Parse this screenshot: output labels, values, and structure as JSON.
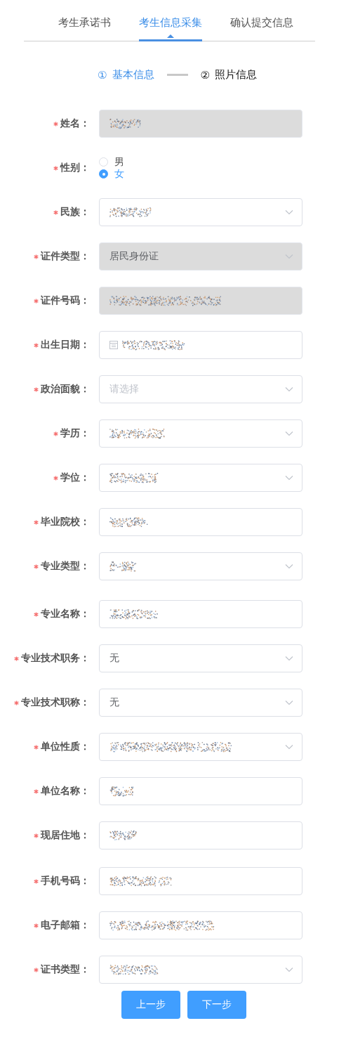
{
  "tabs": [
    {
      "label": "考生承诺书",
      "selected": false
    },
    {
      "label": "考生信息采集",
      "selected": true
    },
    {
      "label": "确认提交信息",
      "selected": false
    }
  ],
  "steps": [
    {
      "number": "①",
      "label": "基本信息",
      "selected": true
    },
    {
      "number": "②",
      "label": "照片信息",
      "selected": false
    }
  ],
  "fields": [
    {
      "label": "姓名：",
      "required": true,
      "kind": "text",
      "disabled": true,
      "obscured": true
    },
    {
      "label": "性别：",
      "required": true,
      "kind": "radio",
      "options": [
        {
          "label": "男",
          "selected": false
        },
        {
          "label": "女",
          "selected": true
        }
      ]
    },
    {
      "label": "民族：",
      "required": true,
      "kind": "select",
      "disabled": false,
      "obscured": true
    },
    {
      "label": "证件类型：",
      "required": true,
      "kind": "select",
      "disabled": true,
      "value": "居民身份证"
    },
    {
      "label": "证件号码：",
      "required": true,
      "kind": "text",
      "disabled": true,
      "obscured": true
    },
    {
      "label": "出生日期：",
      "required": true,
      "kind": "date",
      "disabled": false,
      "obscured": true
    },
    {
      "label": "政治面貌：",
      "required": true,
      "kind": "select",
      "disabled": false,
      "placeholder": "请选择"
    },
    {
      "label": "学历：",
      "required": true,
      "kind": "select",
      "disabled": false,
      "obscured": true
    },
    {
      "label": "学位：",
      "required": true,
      "kind": "select",
      "disabled": false,
      "obscured": true
    },
    {
      "label": "毕业院校：",
      "required": true,
      "kind": "text",
      "disabled": false,
      "obscured": true
    },
    {
      "label": "专业类型：",
      "required": true,
      "kind": "select",
      "disabled": false,
      "obscured": true
    },
    {
      "label": "专业名称：",
      "required": true,
      "kind": "text",
      "disabled": false,
      "obscured": true
    },
    {
      "label": "专业技术职务：",
      "required": true,
      "kind": "select",
      "disabled": false,
      "value": "无"
    },
    {
      "label": "专业技术职称：",
      "required": true,
      "kind": "select",
      "disabled": false,
      "value": "无"
    },
    {
      "label": "单位性质：",
      "required": true,
      "kind": "select",
      "disabled": false,
      "obscured": true
    },
    {
      "label": "单位名称：",
      "required": true,
      "kind": "text",
      "disabled": false,
      "obscured": true
    },
    {
      "label": "现居住地：",
      "required": true,
      "kind": "text",
      "disabled": false,
      "obscured": true
    },
    {
      "label": "手机号码：",
      "required": true,
      "kind": "text",
      "disabled": false,
      "obscured": true
    },
    {
      "label": "电子邮箱：",
      "required": true,
      "kind": "text",
      "disabled": false,
      "obscured": true
    },
    {
      "label": "证书类型：",
      "required": true,
      "kind": "select",
      "disabled": false,
      "obscured": true
    }
  ],
  "buttons": [
    "上一步",
    "下一步"
  ]
}
